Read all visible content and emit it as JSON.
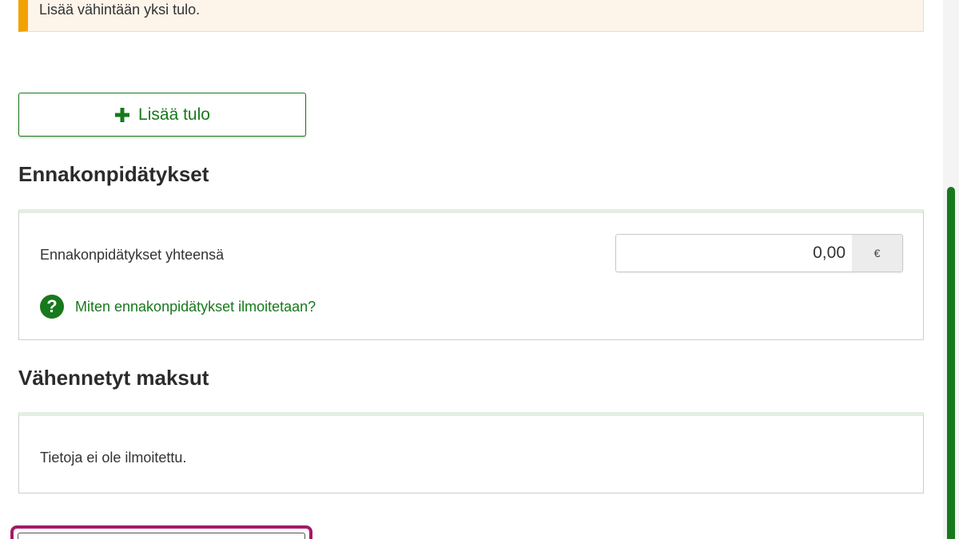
{
  "notice": {
    "text": "Lisää vähintään yksi tulo."
  },
  "add_income": {
    "label": "Lisää tulo",
    "icon": "plus-icon"
  },
  "withholdings": {
    "title": "Ennakonpidätykset",
    "field_label": "Ennakonpidätykset yhteensä",
    "amount": "0,00",
    "unit": "€",
    "help_link": "Miten ennakonpidätykset ilmoitetaan?",
    "help_icon": "?"
  },
  "deducted_payments": {
    "title": "Vähennetyt maksut",
    "empty_text": "Tietoja ei ole ilmoitettu."
  },
  "colors": {
    "accent_green": "#17791c",
    "warning_orange": "#f2a100",
    "focus_magenta": "#a4196b"
  }
}
